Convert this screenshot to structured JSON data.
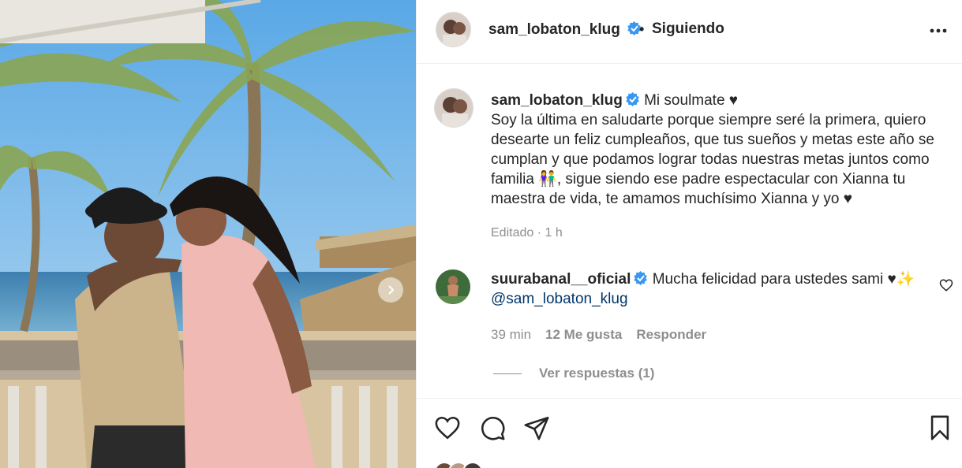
{
  "post": {
    "author": "sam_lobaton_klug",
    "follow_status": "Siguiendo",
    "header_dot": "•",
    "caption_title": "Mi soulmate ♥",
    "caption_body": "Soy la última en saludarte porque siempre seré la primera, quiero desearte un feliz cumpleaños, que tus sueños y metas este año se cumplan y que podamos lograr todas nuestras metas juntos como familia 👫, sigue siendo ese padre espectacular con Xianna tu maestra de vida, te amamos muchísimo Xianna y yo ♥",
    "caption_meta": "Editado · 1 h"
  },
  "comment": {
    "author": "suurabanal__oficial",
    "text": "Mucha felicidad para ustedes sami ♥✨",
    "mention": "@sam_lobaton_klug",
    "time": "39 min",
    "likes": "12 Me gusta",
    "reply": "Responder",
    "view_replies": "Ver respuestas (1)"
  },
  "icons": {
    "more": "more-options-icon",
    "verified": "verified-badge-icon",
    "like": "heart-icon",
    "comment": "comment-icon",
    "share": "share-icon",
    "save": "bookmark-icon",
    "next": "chevron-right-icon"
  },
  "colors": {
    "verified": "#3897f0",
    "text": "#262626",
    "muted": "#8e8e8e",
    "link": "#00376b",
    "divider": "#efefef"
  }
}
